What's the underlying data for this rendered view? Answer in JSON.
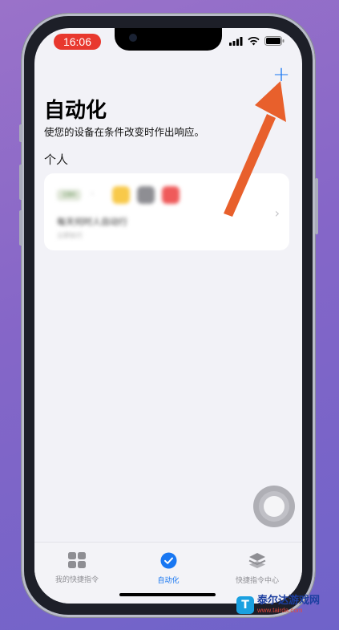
{
  "status_bar": {
    "time": "16:06"
  },
  "header": {
    "add_label": "+"
  },
  "page": {
    "title": "自动化",
    "subtitle": "使您的设备在条件改变时作出响应。",
    "section_label": "个人"
  },
  "automation_card": {
    "trigger_label": "19H",
    "description": "每天何时人自动行",
    "detail": "立即执行"
  },
  "tabbar": {
    "tabs": [
      {
        "label": "我的快捷指令",
        "icon": "grid-icon",
        "active": false
      },
      {
        "label": "自动化",
        "icon": "clock-check-icon",
        "active": true
      },
      {
        "label": "快捷指令中心",
        "icon": "layers-icon",
        "active": false
      }
    ]
  },
  "watermark": {
    "name": "泰尔达游戏网",
    "url": "www.tairda.com"
  },
  "colors": {
    "accent": "#1877f2",
    "annotation_arrow": "#e8602c",
    "time_pill": "#e8382e"
  }
}
